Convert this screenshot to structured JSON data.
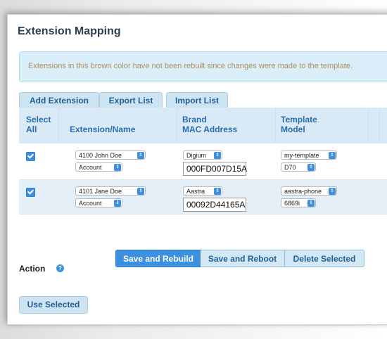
{
  "title": "Extension Mapping",
  "notice": "Extensions in this brown color have not been rebuilt since changes were made to the template.",
  "toolbar": {
    "add_label": "Add Extension",
    "export_label": "Export List",
    "import_label": "Import List"
  },
  "columns": {
    "select_1": "Select",
    "select_2": "All",
    "ext": "Extension/Name",
    "brand_1": "Brand",
    "brand_2": "MAC Address",
    "tpl_1": "Template",
    "tpl_2": "Model"
  },
  "rows": [
    {
      "checked": true,
      "extension": "4100 John Doe",
      "account": "Account",
      "brand": "Digium",
      "mac": "000FD007D15A",
      "template": "my-template",
      "model": "D70"
    },
    {
      "checked": true,
      "extension": "4101 Jane Doe",
      "account": "Account",
      "brand": "Aastra",
      "mac": "00092D44165A",
      "template": "aastra-phone",
      "model": "6869i"
    }
  ],
  "action": {
    "label": "Action",
    "save_rebuild": "Save and Rebuild",
    "save_reboot": "Save and Reboot",
    "delete_selected": "Delete Selected"
  },
  "use_selected": "Use Selected",
  "colors": {
    "accent": "#3d8fe0",
    "notice_text": "#b28d5a",
    "header_bg": "#d9e9f6"
  }
}
